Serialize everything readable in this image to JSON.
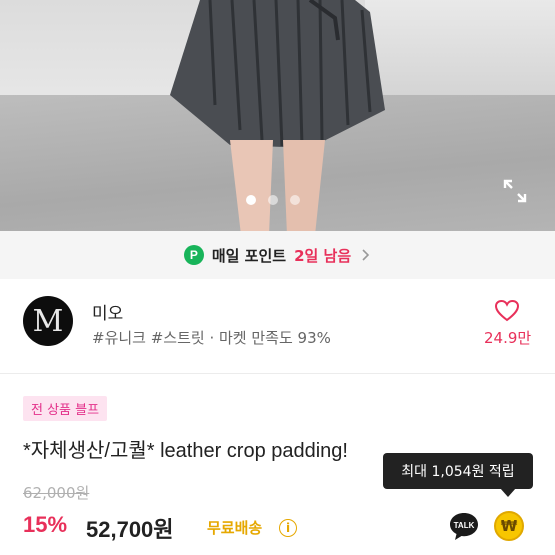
{
  "gallery": {
    "dot_count": 3,
    "active_index": 0,
    "expand_icon": "expand-icon"
  },
  "point_banner": {
    "icon_letter": "P",
    "label": "매일 포인트",
    "remaining": "2일 남음",
    "chevron_icon": "chevron-right-icon"
  },
  "shop": {
    "avatar_letter": "M",
    "name": "미오",
    "tags": "#유니크 #스트릿 · 마켓 만족도 93%",
    "like_count": "24.9만"
  },
  "product": {
    "promo_badge": "전 상품 블프",
    "title": "*자체생산/고퀄* leather crop padding!",
    "original_price": "62,000원",
    "discount": "15%",
    "price": "52,700원",
    "shipping": "무료배송",
    "info_symbol": "i"
  },
  "actions": {
    "tooltip": "최대 1,054원 적립",
    "talk_label": "TALK",
    "coin_symbol": "₩"
  },
  "colors": {
    "accent_pink": "#e8305a",
    "point_green": "#18b45a",
    "shipping_yellow": "#e6a800",
    "coin_yellow": "#f7c600"
  }
}
